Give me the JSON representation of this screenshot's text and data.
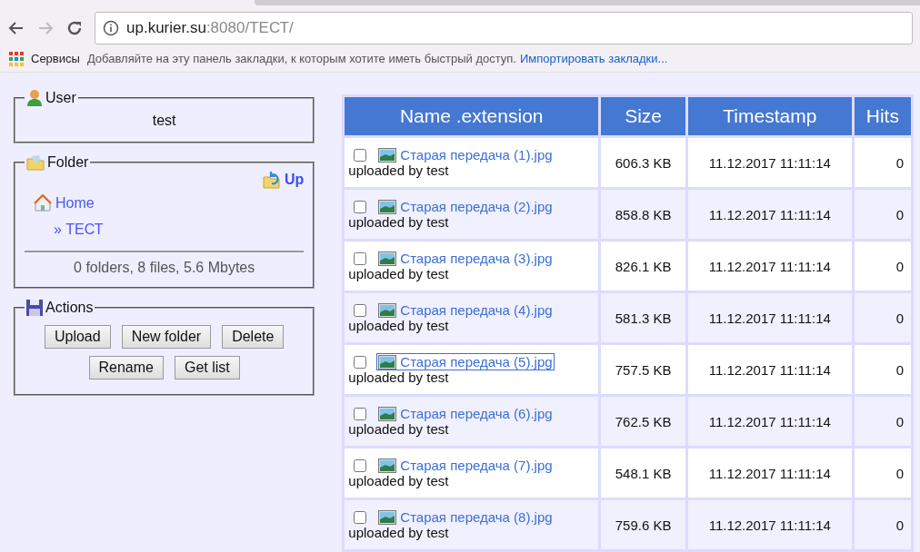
{
  "browser": {
    "url_host": "up.kurier.su",
    "url_rest": ":8080/ТЕСТ/",
    "bookmarks_apps": "Сервисы",
    "bookmarks_hint": "Добавляйте на эту панель закладки, к которым хотите иметь быстрый доступ.",
    "bookmarks_link": "Импортировать закладки..."
  },
  "user_panel": {
    "legend": "User",
    "name": "test"
  },
  "folder_panel": {
    "legend": "Folder",
    "up": "Up",
    "path": [
      {
        "label": "Home",
        "kind": "home"
      },
      {
        "label": "» ТЕСТ",
        "kind": "sub"
      }
    ],
    "summary": "0 folders, 8 files, 5.6 Mbytes"
  },
  "actions_panel": {
    "legend": "Actions",
    "buttons": [
      "Upload",
      "New folder",
      "Delete",
      "Rename",
      "Get list"
    ]
  },
  "table": {
    "columns": [
      "Name .extension",
      "Size",
      "Timestamp",
      "Hits"
    ],
    "rows": [
      {
        "name": "Старая передача (1).jpg",
        "uploader": "uploaded by test",
        "size": "606.3 KB",
        "timestamp": "11.12.2017 11:11:14",
        "hits": "0",
        "checked": false,
        "focused": false
      },
      {
        "name": "Старая передача (2).jpg",
        "uploader": "uploaded by test",
        "size": "858.8 KB",
        "timestamp": "11.12.2017 11:11:14",
        "hits": "0",
        "checked": false,
        "focused": false
      },
      {
        "name": "Старая передача (3).jpg",
        "uploader": "uploaded by test",
        "size": "826.1 KB",
        "timestamp": "11.12.2017 11:11:14",
        "hits": "0",
        "checked": false,
        "focused": false
      },
      {
        "name": "Старая передача (4).jpg",
        "uploader": "uploaded by test",
        "size": "581.3 KB",
        "timestamp": "11.12.2017 11:11:14",
        "hits": "0",
        "checked": false,
        "focused": false
      },
      {
        "name": "Старая передача (5).jpg",
        "uploader": "uploaded by test",
        "size": "757.5 KB",
        "timestamp": "11.12.2017 11:11:14",
        "hits": "0",
        "checked": false,
        "focused": true
      },
      {
        "name": "Старая передача (6).jpg",
        "uploader": "uploaded by test",
        "size": "762.5 KB",
        "timestamp": "11.12.2017 11:11:14",
        "hits": "0",
        "checked": false,
        "focused": false
      },
      {
        "name": "Старая передача (7).jpg",
        "uploader": "uploaded by test",
        "size": "548.1 KB",
        "timestamp": "11.12.2017 11:11:14",
        "hits": "0",
        "checked": false,
        "focused": false
      },
      {
        "name": "Старая передача (8).jpg",
        "uploader": "uploaded by test",
        "size": "759.6 KB",
        "timestamp": "11.12.2017 11:11:14",
        "hits": "0",
        "checked": false,
        "focused": false
      }
    ]
  }
}
